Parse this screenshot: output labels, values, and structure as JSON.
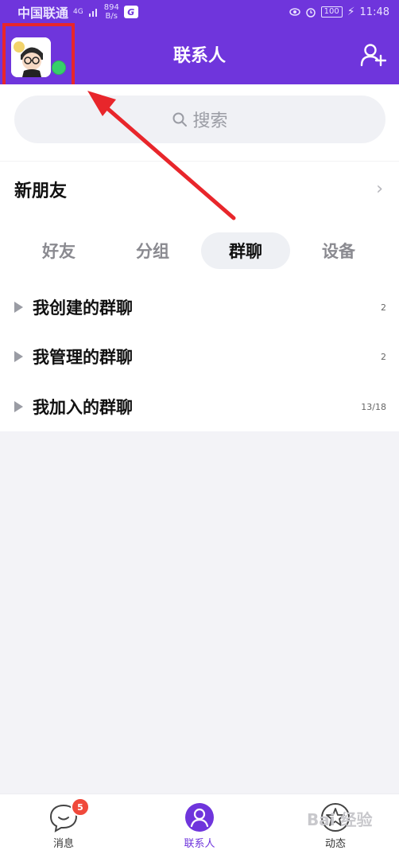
{
  "status_bar": {
    "carrier": "中国联通",
    "network": "4G",
    "speed_value": "894",
    "speed_unit": "B/s",
    "battery": "100",
    "time": "11:48"
  },
  "header": {
    "title": "联系人"
  },
  "search": {
    "placeholder": "搜索"
  },
  "new_friend": {
    "label": "新朋友"
  },
  "tabs": [
    {
      "label": "好友"
    },
    {
      "label": "分组"
    },
    {
      "label": "群聊",
      "active": true
    },
    {
      "label": "设备"
    }
  ],
  "groups": [
    {
      "label": "我创建的群聊",
      "count": "2"
    },
    {
      "label": "我管理的群聊",
      "count": "2"
    },
    {
      "label": "我加入的群聊",
      "count": "13/18"
    }
  ],
  "bottom_nav": [
    {
      "label": "消息",
      "icon": "message-icon",
      "badge": "5"
    },
    {
      "label": "联系人",
      "icon": "contacts-icon",
      "active": true
    },
    {
      "label": "动态",
      "icon": "star-icon"
    }
  ],
  "watermark": "Bai 经验",
  "colors": {
    "accent": "#6f35dc",
    "highlight": "#e8262b",
    "online": "#37d06a",
    "badge": "#f0493b"
  }
}
